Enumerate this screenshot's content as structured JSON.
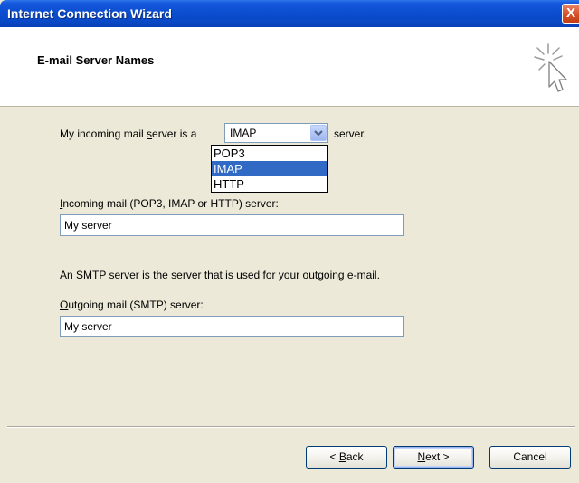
{
  "window": {
    "title": "Internet Connection Wizard",
    "close_label": "X"
  },
  "header": {
    "title": "E-mail Server Names"
  },
  "incoming_type": {
    "label_pre": "My incoming mail ",
    "label_accel": "s",
    "label_post": "erver is a",
    "selected": "IMAP",
    "suffix": "server.",
    "options": [
      "POP3",
      "IMAP",
      "HTTP"
    ]
  },
  "incoming_server": {
    "label_accel": "I",
    "label_rest": "ncoming mail (POP3, IMAP or HTTP) server:",
    "value": "My server"
  },
  "smtp_note": "An SMTP server is the server that is used for your outgoing e-mail.",
  "outgoing_server": {
    "label_accel": "O",
    "label_rest": "utgoing mail (SMTP) server:",
    "value": "My server"
  },
  "buttons": {
    "back_pre": "< ",
    "back_accel": "B",
    "back_post": "ack",
    "next_accel": "N",
    "next_post": "ext >",
    "cancel": "Cancel"
  },
  "colors": {
    "titlebar": "#0a48c6",
    "selection": "#316ac5",
    "dialog_bg": "#ece9d8"
  }
}
